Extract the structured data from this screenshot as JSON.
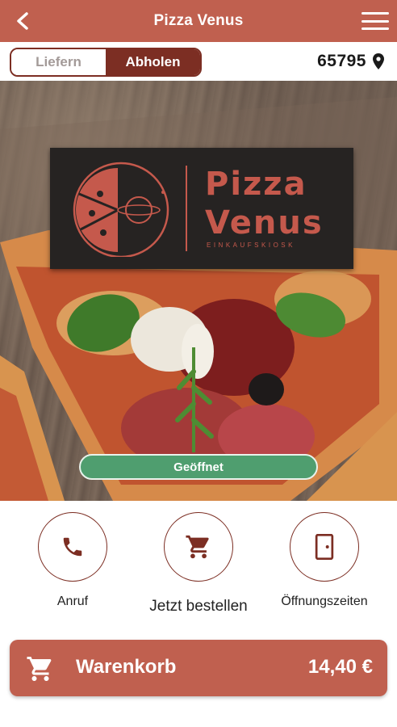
{
  "header": {
    "title": "Pizza Venus",
    "back_icon": "chevron-left-icon",
    "menu_icon": "hamburger-menu-icon"
  },
  "mode_toggle": {
    "options": [
      "Liefern",
      "Abholen"
    ],
    "selected": "Abholen"
  },
  "location": {
    "postal_code": "65795",
    "icon": "map-pin-icon"
  },
  "hero": {
    "logo_line1": "Pizza",
    "logo_line2": "Venus",
    "logo_subtitle": "EINKAUFSKIOSK",
    "status": "Geöffnet"
  },
  "actions": [
    {
      "label": "Anruf",
      "icon": "phone-icon"
    },
    {
      "label": "Jetzt bestellen",
      "icon": "shopping-cart-icon"
    },
    {
      "label": "Öffnungszeiten",
      "icon": "door-icon"
    }
  ],
  "cart": {
    "label": "Warenkorb",
    "total": "14,40 €",
    "icon": "shopping-cart-icon"
  },
  "colors": {
    "brand": "#c0604f",
    "toggle_active": "#7c2e23",
    "status_open": "#4f9e6f"
  }
}
